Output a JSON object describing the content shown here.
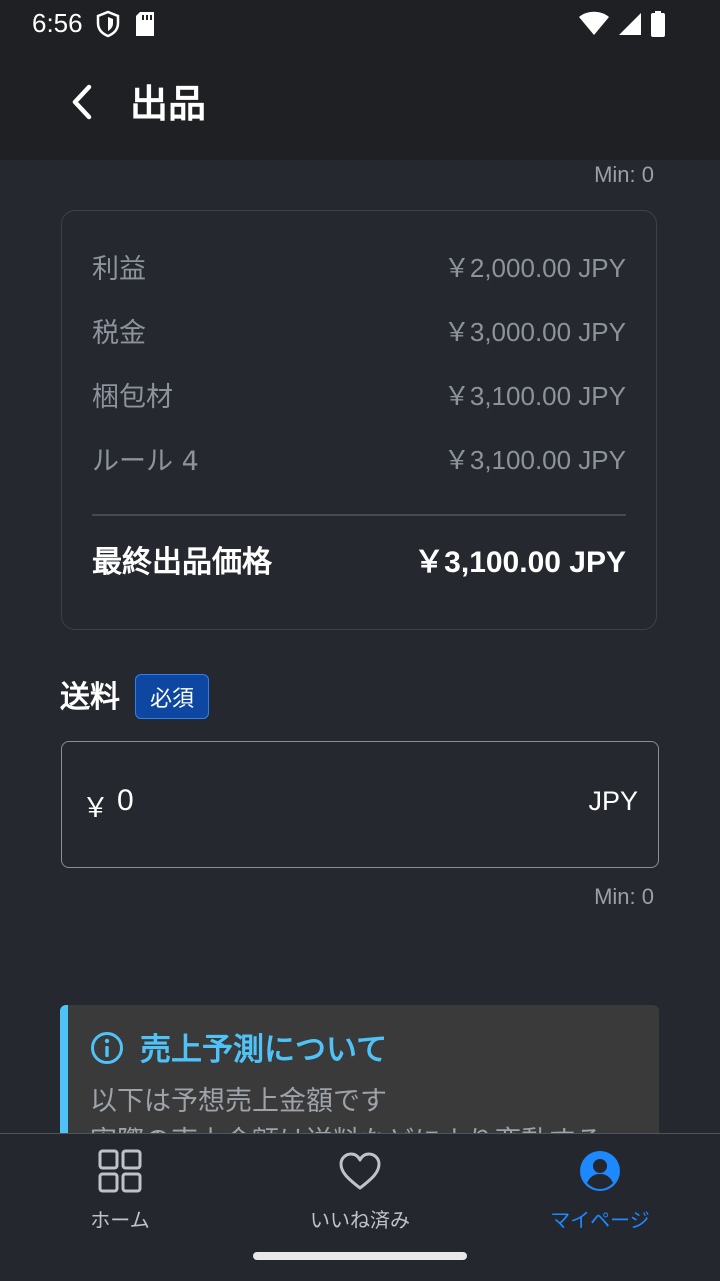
{
  "status_bar": {
    "time": "6:56"
  },
  "header": {
    "title": "出品",
    "back_icon": "chevron-left-icon"
  },
  "pricing": {
    "min_label_top": "Min: 0",
    "rows": [
      {
        "label": "利益",
        "amount": "￥2,000.00 JPY"
      },
      {
        "label": "税金",
        "amount": "￥3,000.00 JPY"
      },
      {
        "label": "梱包材",
        "amount": "￥3,100.00 JPY"
      },
      {
        "label": "ルール 4",
        "amount": "￥3,100.00 JPY"
      }
    ],
    "final_label": "最終出品価格",
    "final_amount": "￥3,100.00 JPY"
  },
  "shipping": {
    "label": "送料",
    "required_badge": "必須",
    "currency_symbol": "￥",
    "value": "0",
    "unit": "JPY",
    "min_label": "Min: 0"
  },
  "sales_forecast": {
    "title": "売上予測について",
    "line1": "以下は予想売上金額です",
    "line2": "実際の売上金額は送料などにより変動する",
    "accent_color": "#4fc3f7"
  },
  "bottom_nav": {
    "items": [
      {
        "label": "ホーム",
        "icon": "grid-icon",
        "active": false
      },
      {
        "label": "いいね済み",
        "icon": "heart-icon",
        "active": false
      },
      {
        "label": "マイページ",
        "icon": "account-circle-icon",
        "active": true
      }
    ],
    "active_color": "#1e88ff"
  }
}
